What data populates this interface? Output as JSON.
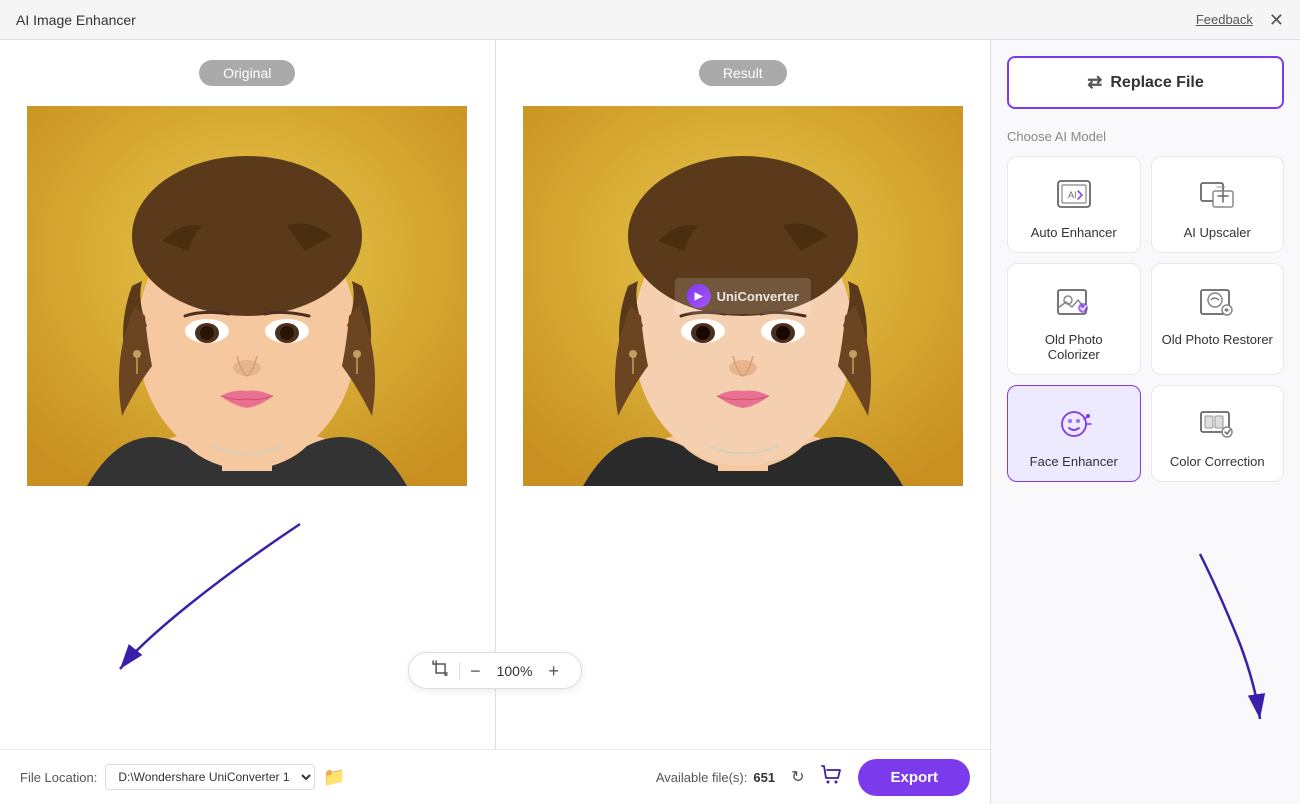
{
  "titleBar": {
    "title": "AI Image Enhancer",
    "feedbackLabel": "Feedback",
    "closeLabel": "✕"
  },
  "imageArea": {
    "originalLabel": "Original",
    "resultLabel": "Result",
    "zoomValue": "100%",
    "watermarkText": "UniConverter"
  },
  "bottomBar": {
    "fileLocationLabel": "File Location:",
    "filePath": "D:\\Wondershare UniConverter 1",
    "availableLabel": "Available file(s):",
    "availableCount": "651",
    "exportLabel": "Export"
  },
  "rightPanel": {
    "replaceFileLabel": "Replace File",
    "chooseModelLabel": "Choose AI Model",
    "models": [
      {
        "id": "auto-enhancer",
        "name": "Auto Enhancer",
        "active": false
      },
      {
        "id": "ai-upscaler",
        "name": "AI Upscaler",
        "active": false
      },
      {
        "id": "old-photo-colorizer",
        "name": "Old Photo Colorizer",
        "active": false
      },
      {
        "id": "old-photo-restorer",
        "name": "Old Photo Restorer",
        "active": false
      },
      {
        "id": "face-enhancer",
        "name": "Face Enhancer",
        "active": true
      },
      {
        "id": "color-correction",
        "name": "Color Correction",
        "active": false
      }
    ]
  }
}
